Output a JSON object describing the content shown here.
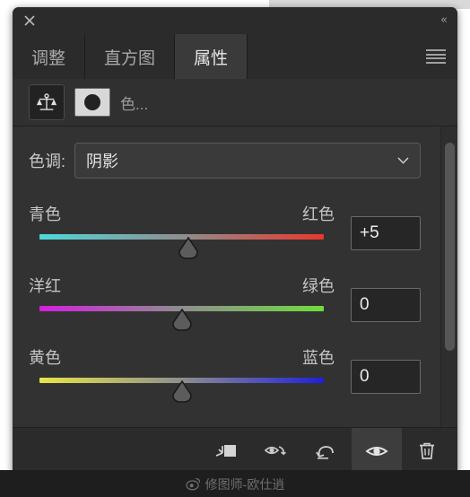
{
  "panel": {
    "titlebar": {
      "close_icon": "close-icon",
      "collapse_label": "«"
    },
    "tabs": [
      {
        "label": "调整",
        "name": "tab-adjustments",
        "active": false
      },
      {
        "label": "直方图",
        "name": "tab-histogram",
        "active": false
      },
      {
        "label": "属性",
        "name": "tab-properties",
        "active": true
      }
    ],
    "menu_icon": "hamburger-menu-icon"
  },
  "adjustment_strip": {
    "adjustment_icon": "color-balance-scale-icon",
    "mask_icon": "layer-mask-thumbnail-icon",
    "title": "色..."
  },
  "tone": {
    "label": "色调:",
    "value": "阴影",
    "chevron_icon": "chevron-down-icon"
  },
  "sliders": [
    {
      "name": "cyan-red",
      "left_label": "青色",
      "right_label": "红色",
      "value": "+5",
      "position_pct": 52.5,
      "gradient_from": "#4fd8db",
      "gradient_mid": "#8e8e8e",
      "gradient_to": "#e8382c"
    },
    {
      "name": "magenta-green",
      "left_label": "洋红",
      "right_label": "绿色",
      "value": "0",
      "position_pct": 50,
      "gradient_from": "#d51fe0",
      "gradient_mid": "#8e8e8e",
      "gradient_to": "#6fdd3c"
    },
    {
      "name": "yellow-blue",
      "left_label": "黄色",
      "right_label": "蓝色",
      "value": "0",
      "position_pct": 50,
      "gradient_from": "#e8e548",
      "gradient_mid": "#8e8e8e",
      "gradient_to": "#2020dd"
    }
  ],
  "scrollbar": {
    "name": "vertical-scrollbar",
    "thumb_top_pct": 3,
    "thumb_height_pct": 73
  },
  "bottom_toolbar": [
    {
      "name": "clip-to-layer-button",
      "icon": "clip-to-layer-icon",
      "active": false
    },
    {
      "name": "view-previous-state-button",
      "icon": "eye-previous-state-icon",
      "active": false
    },
    {
      "name": "reset-button",
      "icon": "reset-arrow-icon",
      "active": false
    },
    {
      "name": "toggle-layer-visibility-button",
      "icon": "eye-icon",
      "active": true
    },
    {
      "name": "delete-layer-button",
      "icon": "trash-icon",
      "active": false
    }
  ],
  "watermark": {
    "icon": "weibo-icon",
    "text": "修图师-欧仕逍"
  }
}
